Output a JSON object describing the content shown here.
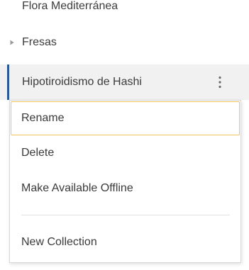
{
  "tree": {
    "rows": [
      {
        "label": "Flora Mediterránea"
      },
      {
        "label": "Fresas",
        "expander": "triangle-right-icon"
      },
      {
        "label": "Hipotiroidismo de Hashi",
        "selected": true,
        "menu_icon": "kebab-vertical-icon"
      }
    ]
  },
  "context_menu": {
    "items": [
      {
        "label": "Rename",
        "focused": true
      },
      {
        "label": "Delete"
      },
      {
        "label": "Make Available Offline"
      },
      {
        "label": "New Collection"
      }
    ]
  },
  "colors": {
    "selection_bar": "#2b5797",
    "selected_row_bg": "#f1f1f1",
    "focus_outline": "#f0c35a",
    "text": "#3a3a3a"
  }
}
